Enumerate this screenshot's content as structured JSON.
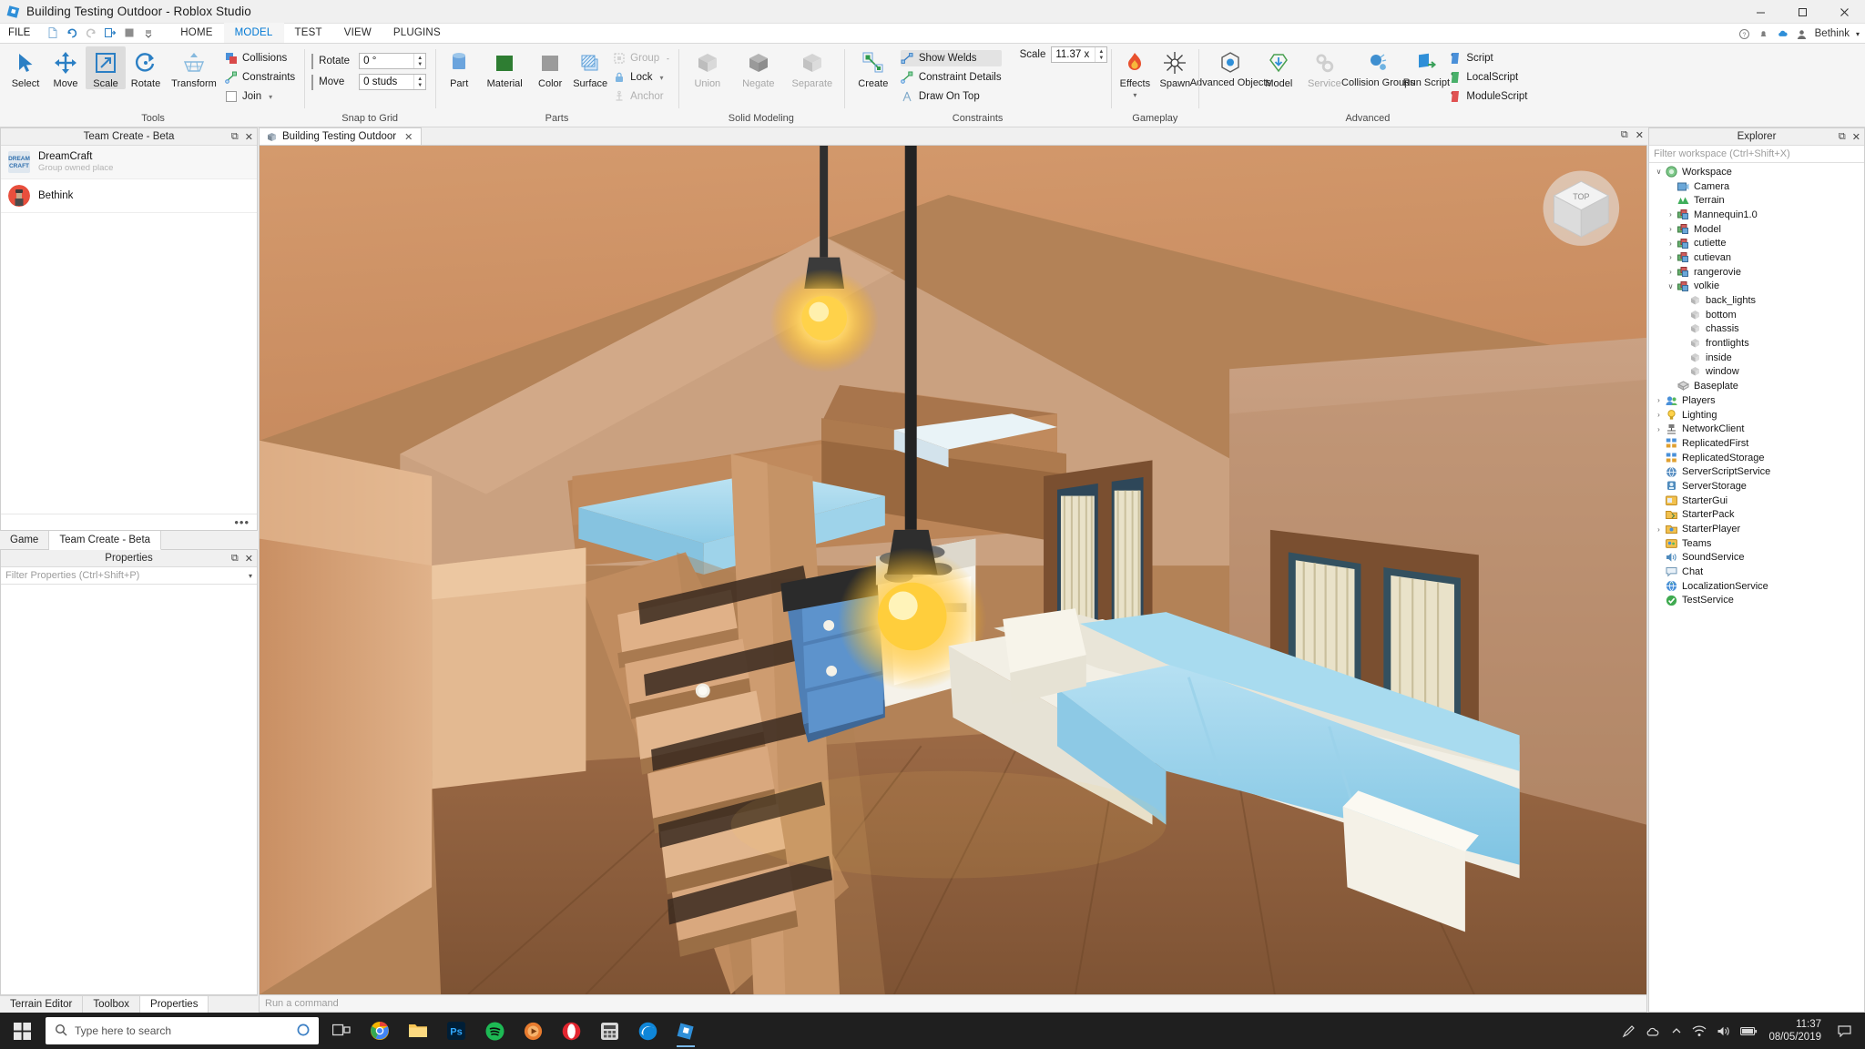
{
  "window": {
    "title": "Building Testing Outdoor - Roblox Studio",
    "minimize": "–",
    "maximize": "❐",
    "close": "✕"
  },
  "menubar": {
    "file_label": "FILE",
    "quick_access": [
      "new-document-icon",
      "undo-icon",
      "redo-icon",
      "publish-icon",
      "stop-icon",
      "customize-icon"
    ],
    "tabs": [
      {
        "label": "HOME",
        "active": false
      },
      {
        "label": "MODEL",
        "active": true
      },
      {
        "label": "TEST",
        "active": false
      },
      {
        "label": "VIEW",
        "active": false
      },
      {
        "label": "PLUGINS",
        "active": false
      }
    ],
    "account_name": "Bethink",
    "account_caret": "▾"
  },
  "ribbon": {
    "groups": [
      {
        "name": "Tools",
        "label": "Tools",
        "buttons": [
          {
            "label": "Select",
            "icon": "cursor-arrow-icon",
            "selected": false
          },
          {
            "label": "Move",
            "icon": "move-arrows-icon",
            "selected": false
          },
          {
            "label": "Scale",
            "icon": "scale-icon",
            "selected": true
          },
          {
            "label": "Rotate",
            "icon": "rotate-icon",
            "selected": false
          },
          {
            "label": "Transform",
            "icon": "transform-icon",
            "selected": false
          }
        ],
        "checks": [
          {
            "label": "Collisions",
            "icon": "collisions-icon",
            "type": "icon"
          },
          {
            "label": "Constraints",
            "icon": "constraints-icon",
            "type": "icon"
          },
          {
            "label": "Join",
            "icon": "join-icon",
            "type": "checkbox",
            "caret": "▾"
          }
        ]
      },
      {
        "name": "Snap to Grid",
        "label": "Snap to Grid",
        "spinners": [
          {
            "label": "Rotate",
            "value": "0 °",
            "checked": false
          },
          {
            "label": "Move",
            "value": "0 studs",
            "checked": false
          }
        ]
      },
      {
        "name": "Parts",
        "label": "Parts",
        "buttons": [
          {
            "label": "Part",
            "icon": "cylinder-part-icon",
            "caret": "▾"
          },
          {
            "label": "Material",
            "icon": "material-swatch-icon",
            "caret": "▾"
          },
          {
            "label": "Color",
            "icon": "color-swatch-icon",
            "caret": "▾"
          },
          {
            "label": "Surface",
            "icon": "surface-icon",
            "caret": "▾"
          }
        ],
        "checks": [
          {
            "label": "Group",
            "icon": "group-icon",
            "dim": true,
            "caret": "-"
          },
          {
            "label": "Lock",
            "icon": "lock-icon",
            "dim": false,
            "caret": "▾"
          },
          {
            "label": "Anchor",
            "icon": "anchor-icon",
            "dim": true
          }
        ]
      },
      {
        "name": "Solid Modeling",
        "label": "Solid Modeling",
        "buttons": [
          {
            "label": "Union",
            "icon": "union-icon",
            "dim": true
          },
          {
            "label": "Negate",
            "icon": "negate-icon",
            "dim": true
          },
          {
            "label": "Separate",
            "icon": "separate-icon",
            "dim": true
          }
        ]
      },
      {
        "name": "Constraints",
        "label": "Constraints",
        "buttons": [
          {
            "label": "Create",
            "icon": "create-constraint-icon",
            "caret": "▾"
          }
        ],
        "checks": [
          {
            "label": "Show Welds",
            "icon": "show-welds-icon",
            "highlighted": true
          },
          {
            "label": "Constraint Details",
            "icon": "constraint-details-icon"
          },
          {
            "label": "Draw On Top",
            "icon": "draw-on-top-icon"
          }
        ]
      },
      {
        "name": "Gameplay",
        "label": "Gameplay",
        "buttons": [
          {
            "label": "Effects",
            "icon": "flame-icon",
            "caret": "▾"
          },
          {
            "label": "Spawn",
            "icon": "spawn-star-icon"
          }
        ]
      },
      {
        "name": "Advanced",
        "label": "Advanced",
        "buttons": [
          {
            "label": "Advanced Objects",
            "icon": "advanced-objects-icon"
          },
          {
            "label": "Model",
            "icon": "model-import-icon"
          },
          {
            "label": "Service",
            "icon": "service-gears-icon",
            "dim": true
          },
          {
            "label": "Collision Groups",
            "icon": "collision-groups-icon"
          },
          {
            "label": "Run Script",
            "icon": "run-script-icon"
          }
        ],
        "scripts": [
          {
            "label": "Script",
            "icon": "script-blue-icon"
          },
          {
            "label": "LocalScript",
            "icon": "script-green-icon"
          },
          {
            "label": "ModuleScript",
            "icon": "script-red-icon"
          }
        ]
      }
    ],
    "scale": {
      "label": "Scale",
      "value": "11.37 x"
    }
  },
  "team_create": {
    "title": "Team Create - Beta",
    "pin": "⧉",
    "close": "✕",
    "members": [
      {
        "name": "DreamCraft",
        "sub": "Group owned place",
        "avatar": "group-logo-avatar"
      },
      {
        "name": "Bethink",
        "sub": "",
        "avatar": "user-avatar"
      }
    ],
    "more": "•••",
    "tabs": [
      {
        "label": "Game",
        "active": false
      },
      {
        "label": "Team Create - Beta",
        "active": true
      }
    ]
  },
  "properties": {
    "title": "Properties",
    "pin": "⧉",
    "close": "✕",
    "filter_placeholder": "Filter Properties (Ctrl+Shift+P)",
    "caret": "▾"
  },
  "viewport": {
    "tab_label": "Building Testing Outdoor",
    "tab_icon": "place-icon",
    "tab_close": "✕",
    "pin": "⧉",
    "close": "✕",
    "nav_widget": "view-cube",
    "nav_label": "TOP"
  },
  "explorer": {
    "title": "Explorer",
    "pin": "⧉",
    "close": "✕",
    "filter_placeholder": "Filter workspace (Ctrl+Shift+X)",
    "tree": [
      {
        "label": "Workspace",
        "depth": 0,
        "twisty": "∨",
        "icon": "workspace-icon"
      },
      {
        "label": "Camera",
        "depth": 1,
        "twisty": "",
        "icon": "camera-icon"
      },
      {
        "label": "Terrain",
        "depth": 1,
        "twisty": "",
        "icon": "terrain-icon"
      },
      {
        "label": "Mannequin1.0",
        "depth": 1,
        "twisty": "›",
        "icon": "model-icon"
      },
      {
        "label": "Model",
        "depth": 1,
        "twisty": "›",
        "icon": "model-icon"
      },
      {
        "label": "cutiette",
        "depth": 1,
        "twisty": "›",
        "icon": "model-icon"
      },
      {
        "label": "cutievan",
        "depth": 1,
        "twisty": "›",
        "icon": "model-icon"
      },
      {
        "label": "rangerovie",
        "depth": 1,
        "twisty": "›",
        "icon": "model-icon"
      },
      {
        "label": "volkie",
        "depth": 1,
        "twisty": "∨",
        "icon": "model-icon"
      },
      {
        "label": "back_lights",
        "depth": 2,
        "twisty": "",
        "icon": "part-icon"
      },
      {
        "label": "bottom",
        "depth": 2,
        "twisty": "",
        "icon": "part-icon"
      },
      {
        "label": "chassis",
        "depth": 2,
        "twisty": "",
        "icon": "part-icon"
      },
      {
        "label": "frontlights",
        "depth": 2,
        "twisty": "",
        "icon": "part-icon"
      },
      {
        "label": "inside",
        "depth": 2,
        "twisty": "",
        "icon": "part-icon"
      },
      {
        "label": "window",
        "depth": 2,
        "twisty": "",
        "icon": "part-icon"
      },
      {
        "label": "Baseplate",
        "depth": 1,
        "twisty": "",
        "icon": "baseplate-icon"
      },
      {
        "label": "Players",
        "depth": 0,
        "twisty": "›",
        "icon": "players-icon"
      },
      {
        "label": "Lighting",
        "depth": 0,
        "twisty": "›",
        "icon": "lighting-icon"
      },
      {
        "label": "NetworkClient",
        "depth": 0,
        "twisty": "›",
        "icon": "network-client-icon"
      },
      {
        "label": "ReplicatedFirst",
        "depth": 0,
        "twisty": "",
        "icon": "replicated-first-icon"
      },
      {
        "label": "ReplicatedStorage",
        "depth": 0,
        "twisty": "",
        "icon": "replicated-storage-icon"
      },
      {
        "label": "ServerScriptService",
        "depth": 0,
        "twisty": "",
        "icon": "server-script-service-icon"
      },
      {
        "label": "ServerStorage",
        "depth": 0,
        "twisty": "",
        "icon": "server-storage-icon"
      },
      {
        "label": "StarterGui",
        "depth": 0,
        "twisty": "",
        "icon": "starter-gui-icon"
      },
      {
        "label": "StarterPack",
        "depth": 0,
        "twisty": "",
        "icon": "starter-pack-icon"
      },
      {
        "label": "StarterPlayer",
        "depth": 0,
        "twisty": "›",
        "icon": "starter-player-icon"
      },
      {
        "label": "Teams",
        "depth": 0,
        "twisty": "",
        "icon": "teams-icon"
      },
      {
        "label": "SoundService",
        "depth": 0,
        "twisty": "",
        "icon": "sound-service-icon"
      },
      {
        "label": "Chat",
        "depth": 0,
        "twisty": "",
        "icon": "chat-icon"
      },
      {
        "label": "LocalizationService",
        "depth": 0,
        "twisty": "",
        "icon": "localization-service-icon"
      },
      {
        "label": "TestService",
        "depth": 0,
        "twisty": "",
        "icon": "test-service-icon"
      }
    ]
  },
  "command_bar": {
    "placeholder": "Run a command"
  },
  "bottom_tabs": [
    {
      "label": "Terrain Editor",
      "active": false
    },
    {
      "label": "Toolbox",
      "active": false
    },
    {
      "label": "Properties",
      "active": true
    }
  ],
  "taskbar": {
    "start": "windows-start-icon",
    "search_placeholder": "Type here to search",
    "search_icon": "search-icon",
    "cortana_icon": "cortana-circle-icon",
    "apps": [
      {
        "name": "task-view-icon"
      },
      {
        "name": "chrome-icon"
      },
      {
        "name": "file-explorer-icon"
      },
      {
        "name": "photoshop-icon"
      },
      {
        "name": "spotify-icon"
      },
      {
        "name": "media-player-icon"
      },
      {
        "name": "opera-icon"
      },
      {
        "name": "calculator-icon"
      },
      {
        "name": "edge-icon"
      },
      {
        "name": "roblox-studio-icon"
      }
    ],
    "tray": [
      "pen-icon",
      "onedrive-icon",
      "chevron-up-icon",
      "wifi-icon",
      "volume-icon",
      "battery-icon"
    ],
    "time": "11:37",
    "date": "08/05/2019",
    "notification": "notification-icon"
  }
}
